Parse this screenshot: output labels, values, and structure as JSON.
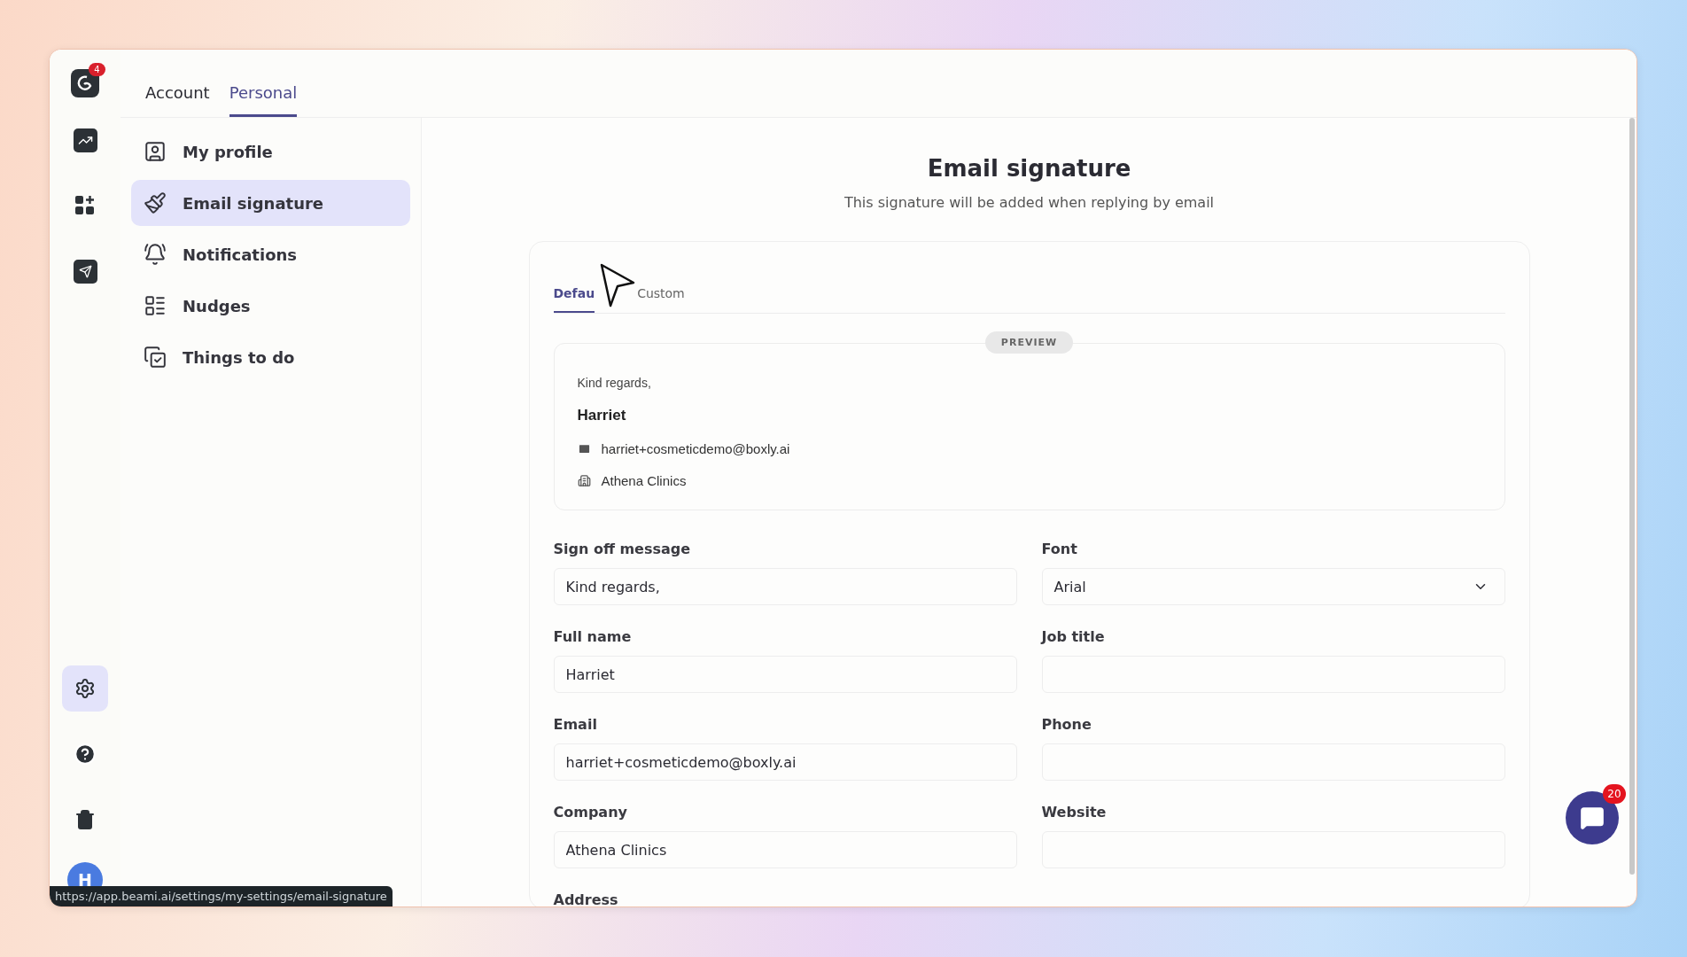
{
  "rail": {
    "logo_badge": "4",
    "items": [
      {
        "kind": "chart",
        "selected": false
      },
      {
        "kind": "apps",
        "selected": false
      },
      {
        "kind": "send",
        "selected": false
      }
    ],
    "bottom_items": [
      {
        "kind": "settings",
        "selected": true
      },
      {
        "kind": "help",
        "selected": false
      },
      {
        "kind": "trash",
        "selected": false
      }
    ],
    "avatar": "H"
  },
  "tabs": [
    {
      "label": "Account",
      "selected": false
    },
    {
      "label": "Personal",
      "selected": true
    }
  ],
  "sidebar": {
    "items": [
      {
        "label": "My profile",
        "kind": "profile",
        "selected": false
      },
      {
        "label": "Email signature",
        "kind": "brush",
        "selected": true
      },
      {
        "label": "Notifications",
        "kind": "bell",
        "selected": false
      },
      {
        "label": "Nudges",
        "kind": "list",
        "selected": false
      },
      {
        "label": "Things to do",
        "kind": "todo",
        "selected": false
      }
    ]
  },
  "page": {
    "title": "Email signature",
    "subtitle": "This signature will be added when replying by email"
  },
  "signature_tabs": [
    {
      "label": "Defau",
      "selected": true
    },
    {
      "label": "Custom",
      "selected": false
    }
  ],
  "preview": {
    "badge": "PREVIEW",
    "sign_off": "Kind regards,",
    "name": "Harriet",
    "email": "harriet+cosmeticdemo@boxly.ai",
    "company": "Athena Clinics"
  },
  "form": {
    "fields": [
      {
        "label": "Sign off message",
        "kind": "text",
        "value": "Kind regards,"
      },
      {
        "label": "Font",
        "kind": "select",
        "value": "Arial"
      },
      {
        "label": "Full name",
        "kind": "text",
        "value": "Harriet"
      },
      {
        "label": "Job title",
        "kind": "text"
      },
      {
        "label": "Email",
        "kind": "text",
        "value": "harriet+cosmeticdemo@boxly.ai"
      },
      {
        "label": "Phone",
        "kind": "text"
      },
      {
        "label": "Company",
        "kind": "text",
        "value": "Athena Clinics"
      },
      {
        "label": "Website",
        "kind": "text"
      },
      {
        "label": "Address",
        "kind": "cut"
      }
    ]
  },
  "chat": {
    "badge": "20"
  },
  "status_url": "https://app.beami.ai/settings/my-settings/email-signature"
}
